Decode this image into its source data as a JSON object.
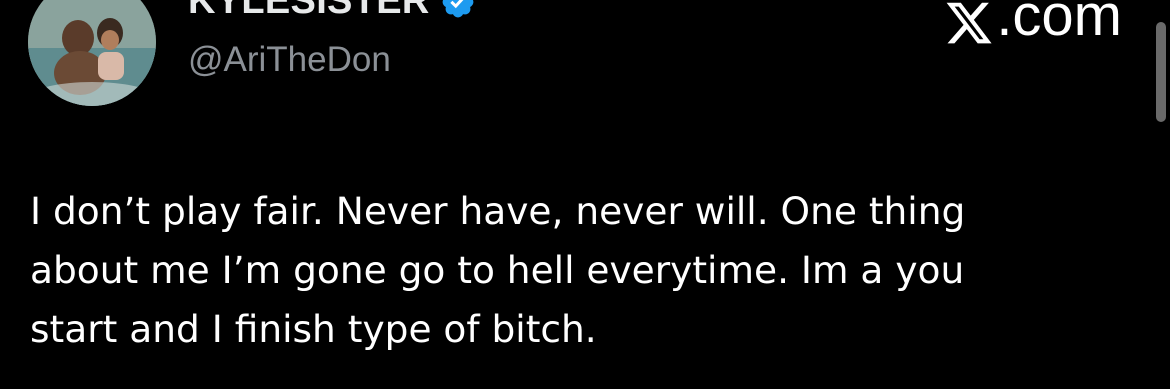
{
  "author": {
    "display_name": "KYLESISTER",
    "handle": "@AriTheDon",
    "verified": true,
    "verified_color": "#1d9bf0"
  },
  "site": {
    "label": ".com",
    "logo_icon": "x-logo-icon"
  },
  "tweet": {
    "lines": [
      "I don’t play fair. Never have, never will. One thing",
      "about me I’m gone go to hell everytime. Im a you",
      "start and I finish type of bitch."
    ]
  },
  "colors": {
    "background": "#000000",
    "text": "#ffffff",
    "secondary_text": "#8b9096"
  }
}
